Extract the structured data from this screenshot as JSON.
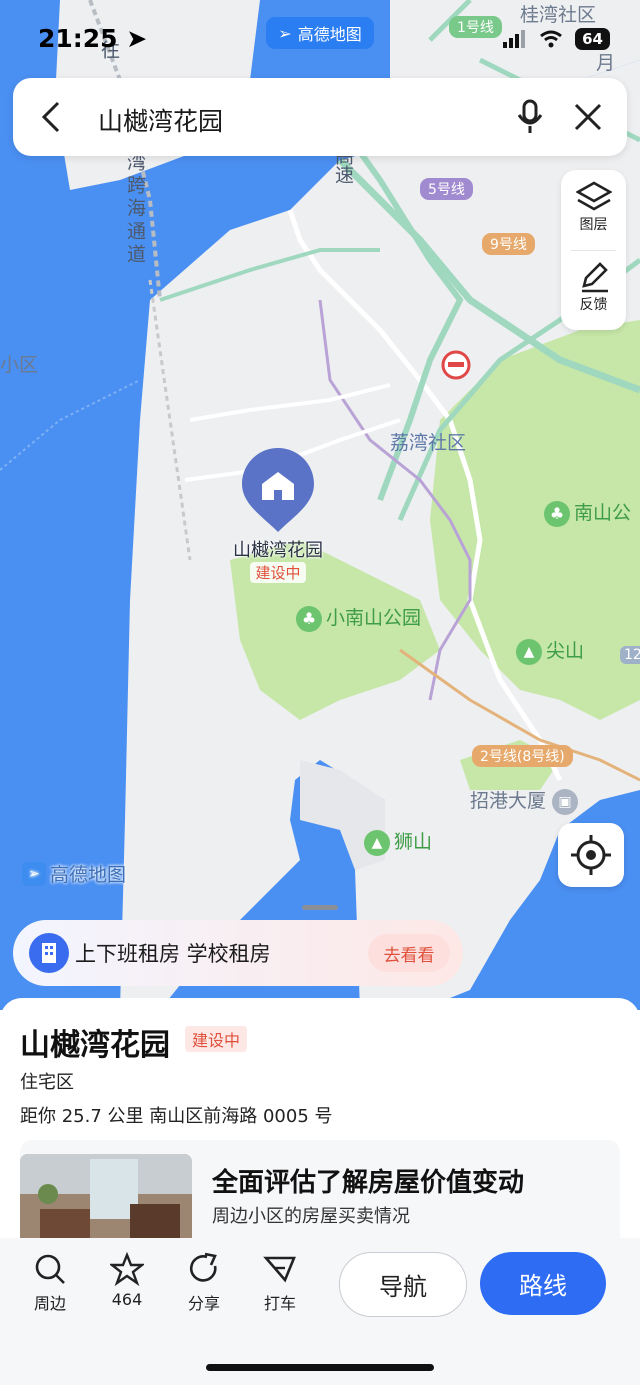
{
  "status_bar": {
    "time": "21:25",
    "battery": "64"
  },
  "brand_pill": "高德地图",
  "search": {
    "query": "山樾湾花园"
  },
  "side_panel": {
    "layers": "图层",
    "feedback": "反馈"
  },
  "map_labels": {
    "community_top": "桂湾社区",
    "line1": "1号线",
    "line5": "5号线",
    "line9": "9号线",
    "line2": "2号线(8号线)",
    "community_mid": "荔湾社区",
    "community_left": "小区",
    "nanshan_park": "南山公",
    "xiaonanshan": "小南山公园",
    "jianshan": "尖山",
    "shishan": "狮山",
    "zhaogang": "招港大厦",
    "road_12": "12",
    "road_yue": "月",
    "road_gaosu": "高速",
    "road_bridge": "湾跨海通道",
    "road_top": "往",
    "amap_logo": "高德地图"
  },
  "marker": {
    "name": "山樾湾花园",
    "status": "建设中"
  },
  "promo": {
    "text": "上下班租房 学校租房",
    "button": "去看看"
  },
  "place": {
    "title": "山樾湾花园",
    "badge": "建设中",
    "category": "住宅区",
    "distance_address": "距你 25.7 公里   南山区前海路 0005 号"
  },
  "card": {
    "title": "全面评估了解房屋价值变动",
    "subtitle": "周边小区的房屋买卖情况"
  },
  "toolbar": {
    "nearby": "周边",
    "favorites": "464",
    "share": "分享",
    "taxi": "打车",
    "navigate": "导航",
    "route": "路线"
  },
  "colors": {
    "accent": "#2e6cf3",
    "water": "#4a8ff2",
    "land": "#eeeff1",
    "park": "#c6e7a8",
    "badge": "#e0503c"
  }
}
